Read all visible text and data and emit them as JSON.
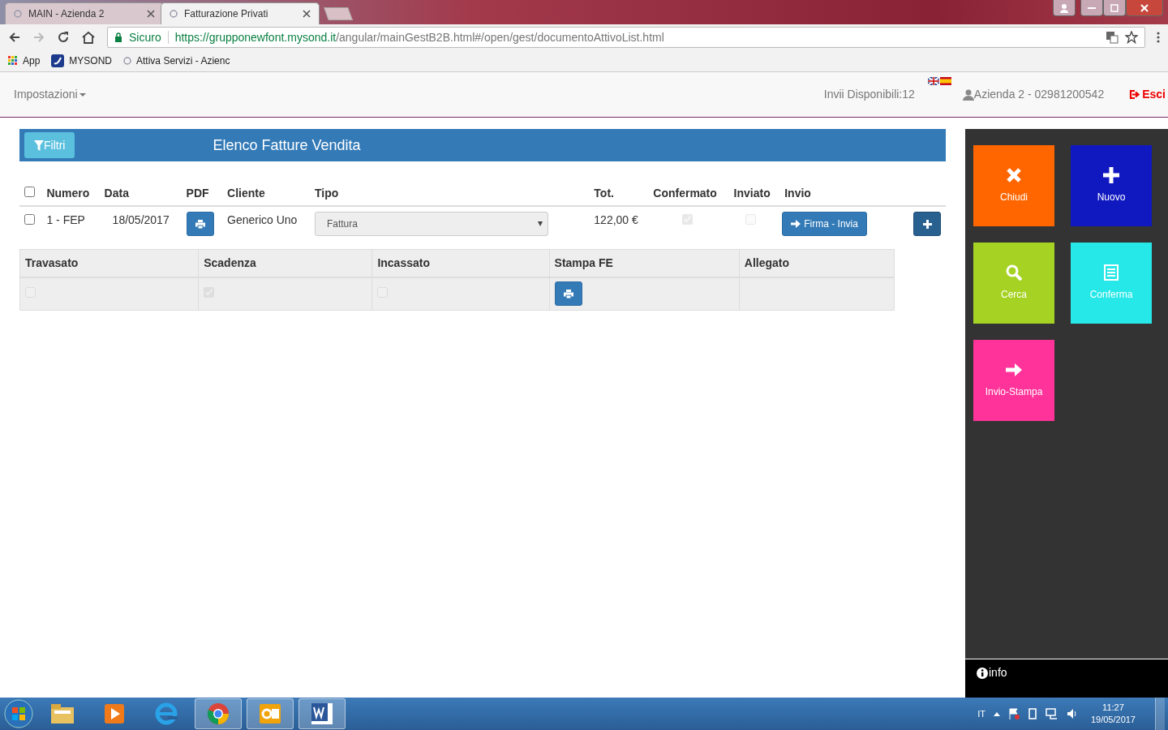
{
  "browser": {
    "tabs": [
      {
        "title": "MAIN - Azienda 2",
        "selected": false
      },
      {
        "title": "Fatturazione Privati",
        "selected": true
      }
    ],
    "address": {
      "secure_label": "Sicuro",
      "host": "https://grupponewfont.mysond.it",
      "path": "/angular/mainGestB2B.html#/open/gest/documentoAttivoList.html"
    },
    "bookmarks": [
      {
        "label": "App",
        "kind": "apps"
      },
      {
        "label": "MYSOND",
        "kind": "brand"
      },
      {
        "label": "Attiva Servizi - Azienc",
        "kind": "page"
      }
    ]
  },
  "navbar": {
    "settings_menu": "Impostazioni",
    "credits": "Invii Disponibili:12",
    "user": "Azienda 2 - 02981200542",
    "logout": "Esci"
  },
  "panel": {
    "filter_button": "Filtri",
    "title": "Elenco Fatture Vendita"
  },
  "table": {
    "columns": [
      "Numero",
      "Data",
      "PDF",
      "Cliente",
      "Tipo",
      "Tot.",
      "Confermato",
      "Inviato",
      "Invio"
    ],
    "select_all_checked": false,
    "rows": [
      {
        "checked": false,
        "numero": "1 - FEP",
        "data": "18/05/2017",
        "cliente": "Generico Uno",
        "tipo": "Fattura",
        "tot": "122,00 €",
        "confermato": true,
        "inviato": false,
        "invio_button": "Firma - Invia"
      }
    ]
  },
  "detail": {
    "columns": [
      "Travasato",
      "Scadenza",
      "Incassato",
      "Stampa FE",
      "Allegato"
    ],
    "travasato": false,
    "scadenza": true,
    "incassato": false
  },
  "tiles": [
    {
      "label": "Chiudi",
      "kind": "close",
      "color": "#ff6600"
    },
    {
      "label": "Nuovo",
      "kind": "plus",
      "color": "#1019c0"
    },
    {
      "label": "Cerca",
      "kind": "search",
      "color": "#a6d323"
    },
    {
      "label": "Conferma",
      "kind": "list",
      "color": "#27e8e8"
    },
    {
      "label": "Invio-Stampa",
      "kind": "arrow",
      "color": "#ff3399"
    }
  ],
  "info": "info",
  "taskbar": {
    "apps": [
      {
        "kind": "explorer",
        "active": false
      },
      {
        "kind": "media",
        "active": false
      },
      {
        "kind": "ie",
        "active": false
      },
      {
        "kind": "chrome",
        "active": true
      },
      {
        "kind": "outlook",
        "active": true
      },
      {
        "kind": "word",
        "active": true
      }
    ],
    "language": "IT",
    "time": "11:27",
    "date": "19/05/2017"
  }
}
